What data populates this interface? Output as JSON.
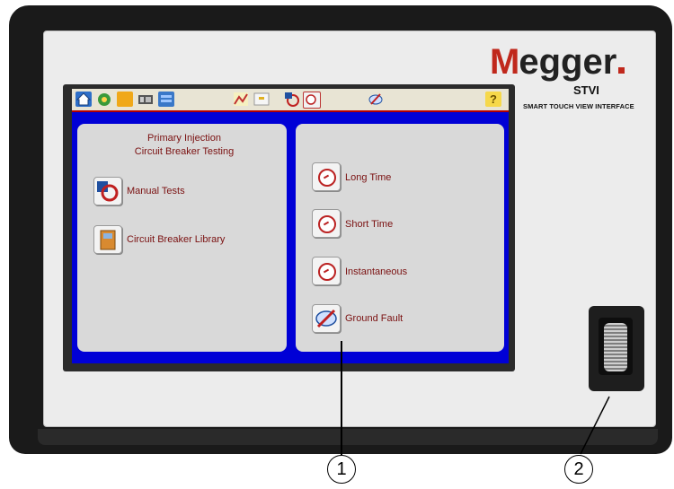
{
  "brand": {
    "logo_initial": "M",
    "logo_rest": "egger",
    "model": "STVI",
    "model_subtitle": "SMART TOUCH VIEW INTERFACE"
  },
  "toolbar": {
    "icons": [
      "home-icon",
      "settings-icon",
      "folder-icon",
      "devices-icon",
      "display-icon",
      "chart-icon",
      "terminal-icon",
      "manual-test-icon",
      "timer-icon",
      "ground-fault-icon"
    ],
    "help_label": "?"
  },
  "left_panel": {
    "title_line1": "Primary Injection",
    "title_line2": "Circuit Breaker Testing",
    "items": [
      {
        "label": "Manual Tests",
        "icon": "manual-test-icon"
      },
      {
        "label": "Circuit Breaker Library",
        "icon": "breaker-library-icon"
      }
    ]
  },
  "right_panel": {
    "items": [
      {
        "label": "Long Time",
        "icon": "clock-icon"
      },
      {
        "label": "Short Time",
        "icon": "clock-icon"
      },
      {
        "label": "Instantaneous",
        "icon": "clock-icon"
      },
      {
        "label": "Ground Fault",
        "icon": "ground-fault-icon"
      }
    ]
  },
  "callouts": {
    "screen": "1",
    "knob": "2"
  },
  "colors": {
    "brand_red": "#c0281c",
    "screen_blue": "#0000d6",
    "text_red": "#7a1010",
    "panel_gray": "#d9d9d9"
  }
}
